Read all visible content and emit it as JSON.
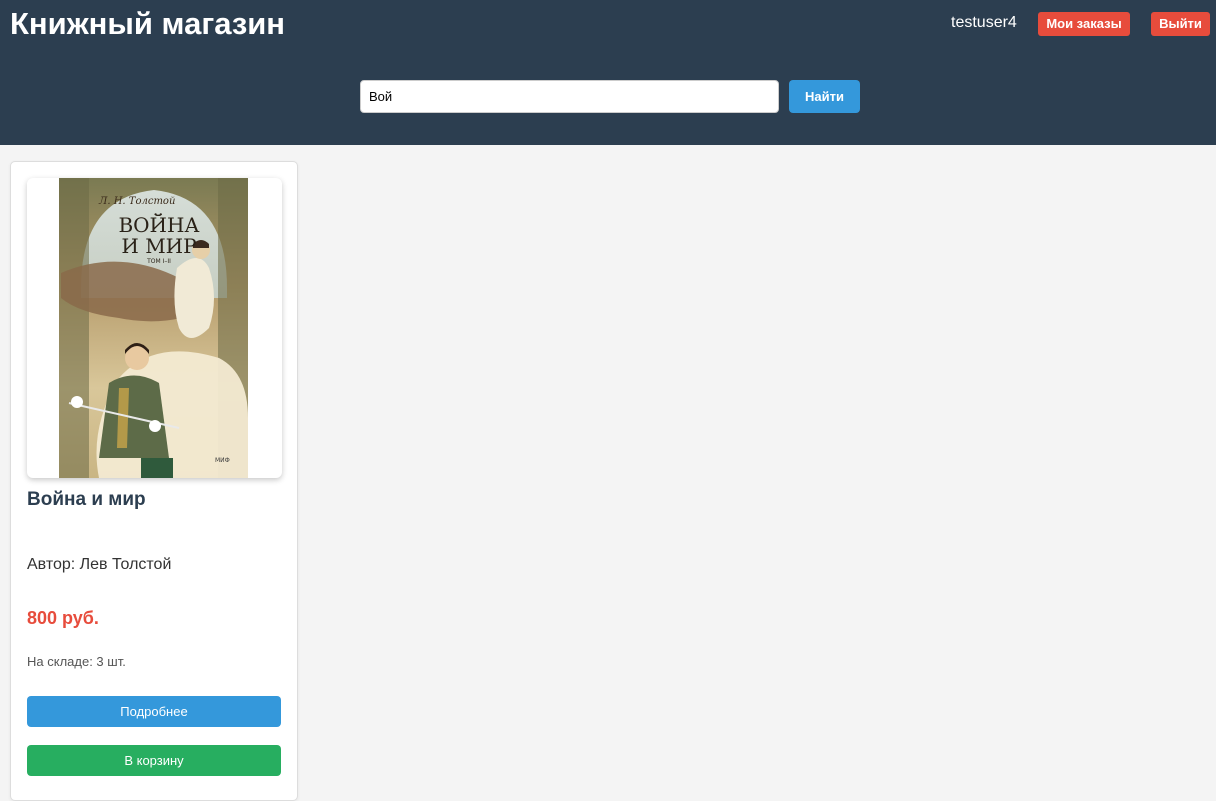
{
  "header": {
    "title": "Книжный магазин",
    "username": "testuser4",
    "orders_label": "Мои заказы",
    "logout_label": "Выйти"
  },
  "search": {
    "value": "Вой",
    "button_label": "Найти"
  },
  "books": [
    {
      "title": "Война и мир",
      "author": "Автор: Лев Толстой",
      "price": "800 руб.",
      "stock": "На складе: 3 шт.",
      "details_label": "Подробнее",
      "cart_label": "В корзину",
      "cover": {
        "author_script": "Л. Н. Толстой",
        "title_line1": "ВОЙНА",
        "title_line2": "И МИР",
        "volume": "ТОМ I–II",
        "publisher": "МИФ"
      }
    }
  ],
  "colors": {
    "header_bg": "#2c3e50",
    "page_bg": "#f4f4f4",
    "danger": "#e74c3c",
    "primary": "#3498db",
    "success": "#27ae60"
  }
}
